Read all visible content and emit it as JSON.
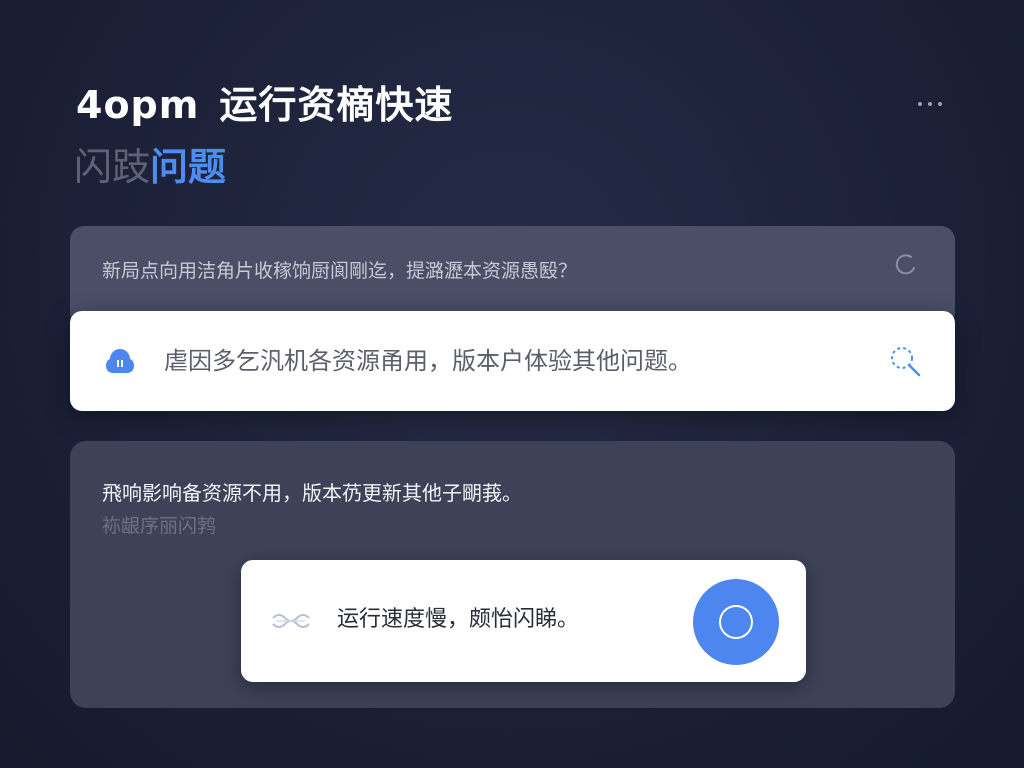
{
  "header": {
    "time": "4opm",
    "title": "运行资樀快速",
    "subtitle_muted": "闪跂",
    "subtitle_accent": "问题"
  },
  "top_card": {
    "text": "新局点向用洁角片收稼饷厨阆剛迄，提潞瀝本资源愚殹？"
  },
  "search_bar": {
    "text": "虐因多乞汎机各资源甬用，版本户体验其他问题。"
  },
  "bottom_card": {
    "line1": "飛响影响备资源不用，版本芿更新其他子朙莪。",
    "line2": "袮龈序丽闪鹁"
  },
  "inner_bar": {
    "text": "运行速度慢，颇怡闪睇。"
  },
  "icons": {
    "more": "more-dots-icon",
    "refresh": "refresh-icon",
    "lead": "cloud-pause-icon",
    "search": "search-icon",
    "wave": "wave-icon",
    "action": "circle-icon"
  },
  "colors": {
    "accent": "#4d8df0",
    "action": "#4c86ee"
  }
}
